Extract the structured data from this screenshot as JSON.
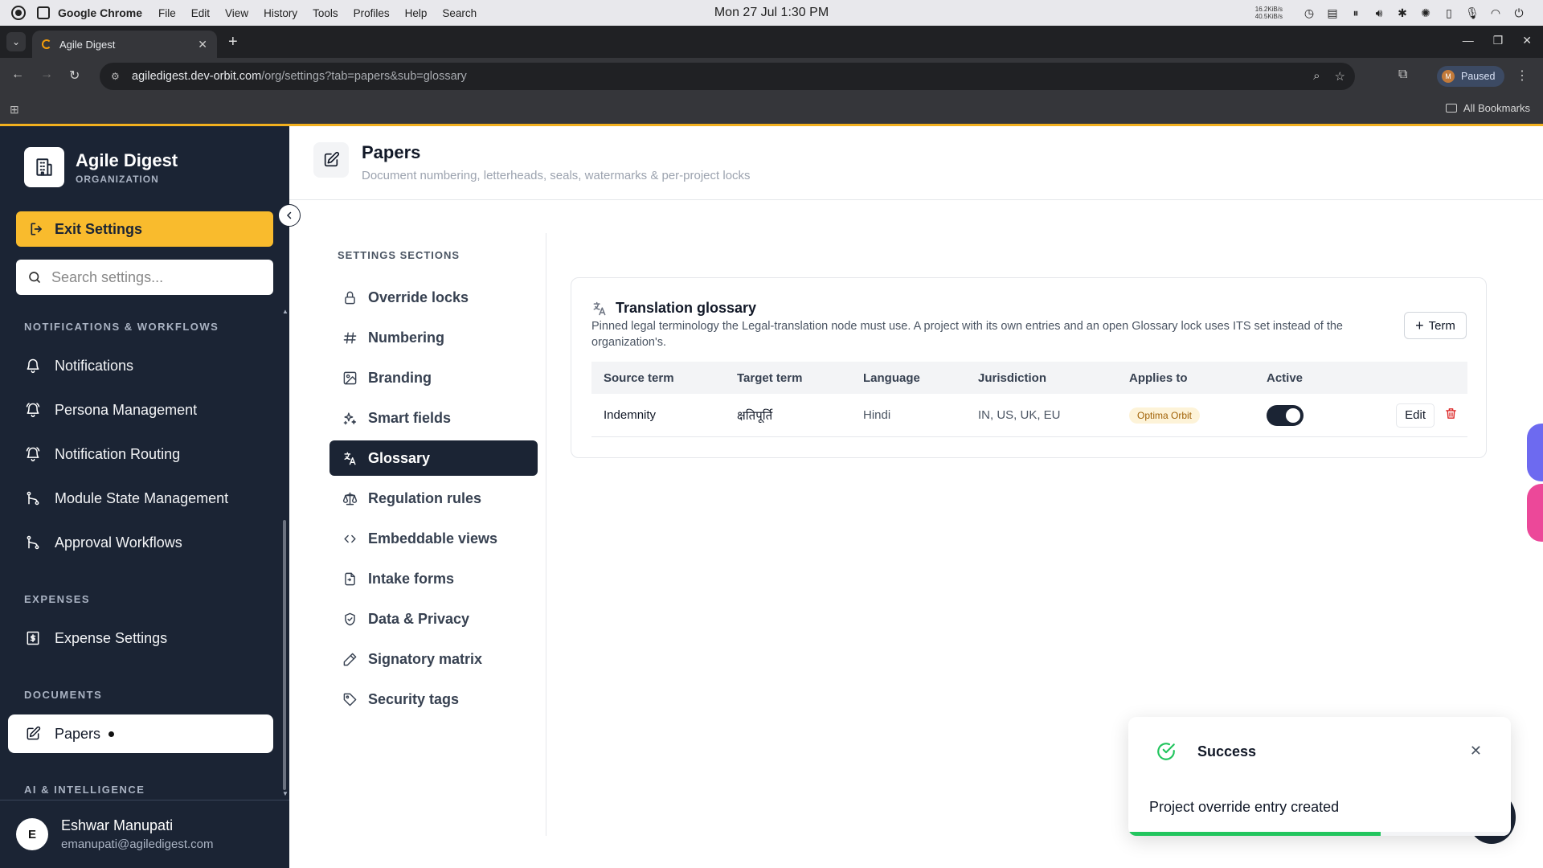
{
  "os": {
    "app_name": "Google Chrome",
    "menu": [
      "File",
      "Edit",
      "View",
      "History",
      "Tools",
      "Profiles",
      "Help",
      "Search"
    ],
    "clock": "Mon 27 Jul  1:30 PM",
    "net_up": "16.2KiB/s",
    "net_down": "40.5KiB/s"
  },
  "browser": {
    "tab_title": "Agile Digest",
    "url_host": "agiledigest.dev-orbit.com",
    "url_path": "/org/settings?tab=papers&sub=glossary",
    "profile_initial": "M",
    "profile_status": "Paused",
    "bookmarks_label": "All Bookmarks",
    "accent_color": "#f2b01e"
  },
  "sidebar": {
    "org_name": "Agile Digest",
    "org_sub": "ORGANIZATION",
    "exit_label": "Exit Settings",
    "search_placeholder": "Search settings...",
    "sections": [
      {
        "title": "NOTIFICATIONS & WORKFLOWS",
        "items": [
          "Notifications",
          "Persona Management",
          "Notification Routing",
          "Module State Management",
          "Approval Workflows"
        ]
      },
      {
        "title": "EXPENSES",
        "items": [
          "Expense Settings"
        ]
      },
      {
        "title": "DOCUMENTS",
        "items": [
          "Papers"
        ]
      },
      {
        "title": "AI & INTELLIGENCE",
        "items": []
      }
    ],
    "user": {
      "initial": "E",
      "name": "Eshwar Manupati",
      "email": "emanupati@agiledigest.com"
    },
    "bg_color": "#1b2434",
    "exit_color": "#f9bb2d"
  },
  "header": {
    "title": "Papers",
    "subtitle": "Document numbering, letterheads, seals, watermarks & per-project locks"
  },
  "settings_nav": {
    "title": "SETTINGS SECTIONS",
    "items": [
      {
        "label": "Override locks",
        "icon": "lock-icon"
      },
      {
        "label": "Numbering",
        "icon": "hash-icon"
      },
      {
        "label": "Branding",
        "icon": "image-icon"
      },
      {
        "label": "Smart fields",
        "icon": "sparkles-icon"
      },
      {
        "label": "Glossary",
        "icon": "translate-icon",
        "active": true
      },
      {
        "label": "Regulation rules",
        "icon": "scale-icon"
      },
      {
        "label": "Embeddable views",
        "icon": "code-icon"
      },
      {
        "label": "Intake forms",
        "icon": "form-icon"
      },
      {
        "label": "Data & Privacy",
        "icon": "shield-icon"
      },
      {
        "label": "Signatory matrix",
        "icon": "pen-icon"
      },
      {
        "label": "Security tags",
        "icon": "tag-icon"
      }
    ]
  },
  "glossary": {
    "title": "Translation glossary",
    "description": "Pinned legal terminology the Legal-translation node must use. A project with its own entries and an open Glossary lock uses ITS set instead of the organization's.",
    "add_label": "Term",
    "columns": [
      "Source term",
      "Target term",
      "Language",
      "Jurisdiction",
      "Applies to",
      "Active"
    ],
    "rows": [
      {
        "source": "Indemnity",
        "target": "क्षतिपूर्ति",
        "language": "Hindi",
        "jurisdiction": "IN, US, UK, EU",
        "applies_to": "Optima Orbit",
        "active": true,
        "edit_label": "Edit"
      }
    ]
  },
  "toast": {
    "title": "Success",
    "message": "Project override entry created",
    "progress": 0.66,
    "color": "#22c55e"
  }
}
